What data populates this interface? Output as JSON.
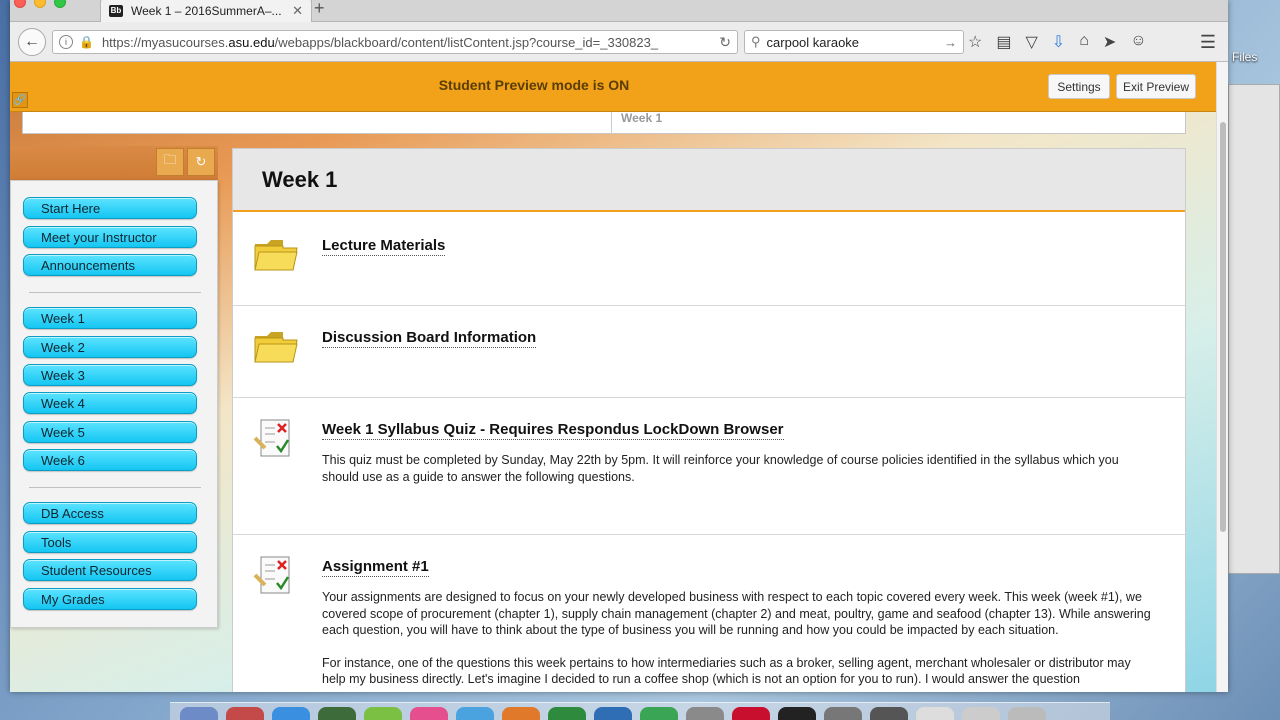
{
  "desktop": {
    "files_label": "Files"
  },
  "browser": {
    "tab": {
      "favicon": "Bb",
      "title": "Week 1 – 2016SummerA–...",
      "close": "✕"
    },
    "new_tab": "+",
    "address": {
      "prefix": "https://myasucourses.",
      "domain": "asu.edu",
      "path": "/webapps/blackboard/content/listContent.jsp?course_id=_330823_"
    },
    "search": {
      "query": "carpool karaoke"
    }
  },
  "preview_bar": {
    "message": "Student Preview mode is ON",
    "settings_label": "Settings",
    "exit_label": "Exit Preview"
  },
  "breadcrumb": {
    "current": "Week 1"
  },
  "course_menu": {
    "group1": [
      "Start Here",
      "Meet your Instructor",
      "Announcements"
    ],
    "group2": [
      "Week 1",
      "Week 2",
      "Week 3",
      "Week 4",
      "Week 5",
      "Week 6"
    ],
    "group3": [
      "DB Access",
      "Tools",
      "Student Resources",
      "My Grades"
    ]
  },
  "content": {
    "title": "Week 1",
    "items": [
      {
        "type": "folder",
        "title": "Lecture Materials"
      },
      {
        "type": "folder",
        "title": "Discussion Board Information"
      },
      {
        "type": "test",
        "title": "Week 1 Syllabus Quiz - Requires Respondus LockDown Browser",
        "description": "This quiz must be completed by Sunday, May 22th by 5pm.  It will reinforce your knowledge of course policies identified in the syllabus which you should use as a guide to answer the following questions."
      },
      {
        "type": "assignment",
        "title": "Assignment #1",
        "description_p1": "Your assignments are designed to focus on your newly developed business with respect to each topic covered every week.  This week (week #1), we covered scope of procurement (chapter 1), supply chain management (chapter 2) and meat, poultry, game and seafood (chapter 13). While answering each question, you will have to think about the type of business you will be running and how you could be impacted by each situation.",
        "description_p2": "For instance, one of the questions this week pertains to how intermediaries such as a broker, selling agent, merchant wholesaler or distributor may help my business directly.  Let's imagine I decided to run a coffee shop (which is not an option for you to run). I would answer the question"
      }
    ]
  }
}
